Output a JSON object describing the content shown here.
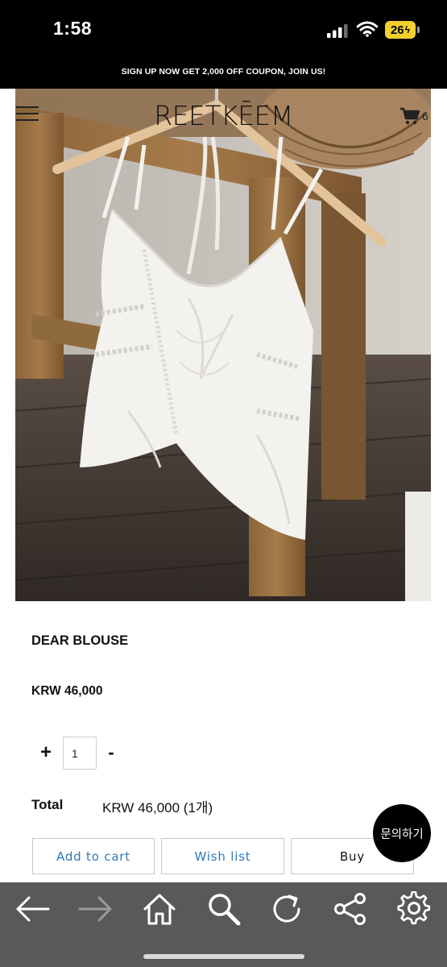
{
  "status_bar": {
    "time": "1:58",
    "battery": "26",
    "icons": [
      "signal-icon",
      "wifi-icon",
      "battery-icon"
    ]
  },
  "promo": {
    "text": "SIGN UP NOW GET 2,000 OFF COUPON, JOIN US!"
  },
  "header": {
    "brand": "REETKĒEM",
    "cart_count": "6",
    "icons": [
      "menu-icon",
      "cart-icon"
    ]
  },
  "product": {
    "image_desc_icon": "product-photo",
    "name": "DEAR BLOUSE",
    "price": "KRW 46,000",
    "quantity": "1",
    "plus_label": "+",
    "minus_label": "-",
    "total_label": "Total",
    "total_value": "KRW 46,000 (1개)"
  },
  "actions": {
    "add_to_cart": "Add to cart",
    "wish_list": "Wish list",
    "buy": "Buy",
    "inquiry": "문의하기"
  },
  "toolbar": {
    "icons": [
      "back-arrow-icon",
      "forward-arrow-icon",
      "home-icon",
      "search-icon",
      "reload-icon",
      "share-icon",
      "settings-icon"
    ]
  },
  "colors": {
    "accent_link": "#2f79b5",
    "toolbar_bg": "#595959",
    "battery": "#f2d12e"
  }
}
